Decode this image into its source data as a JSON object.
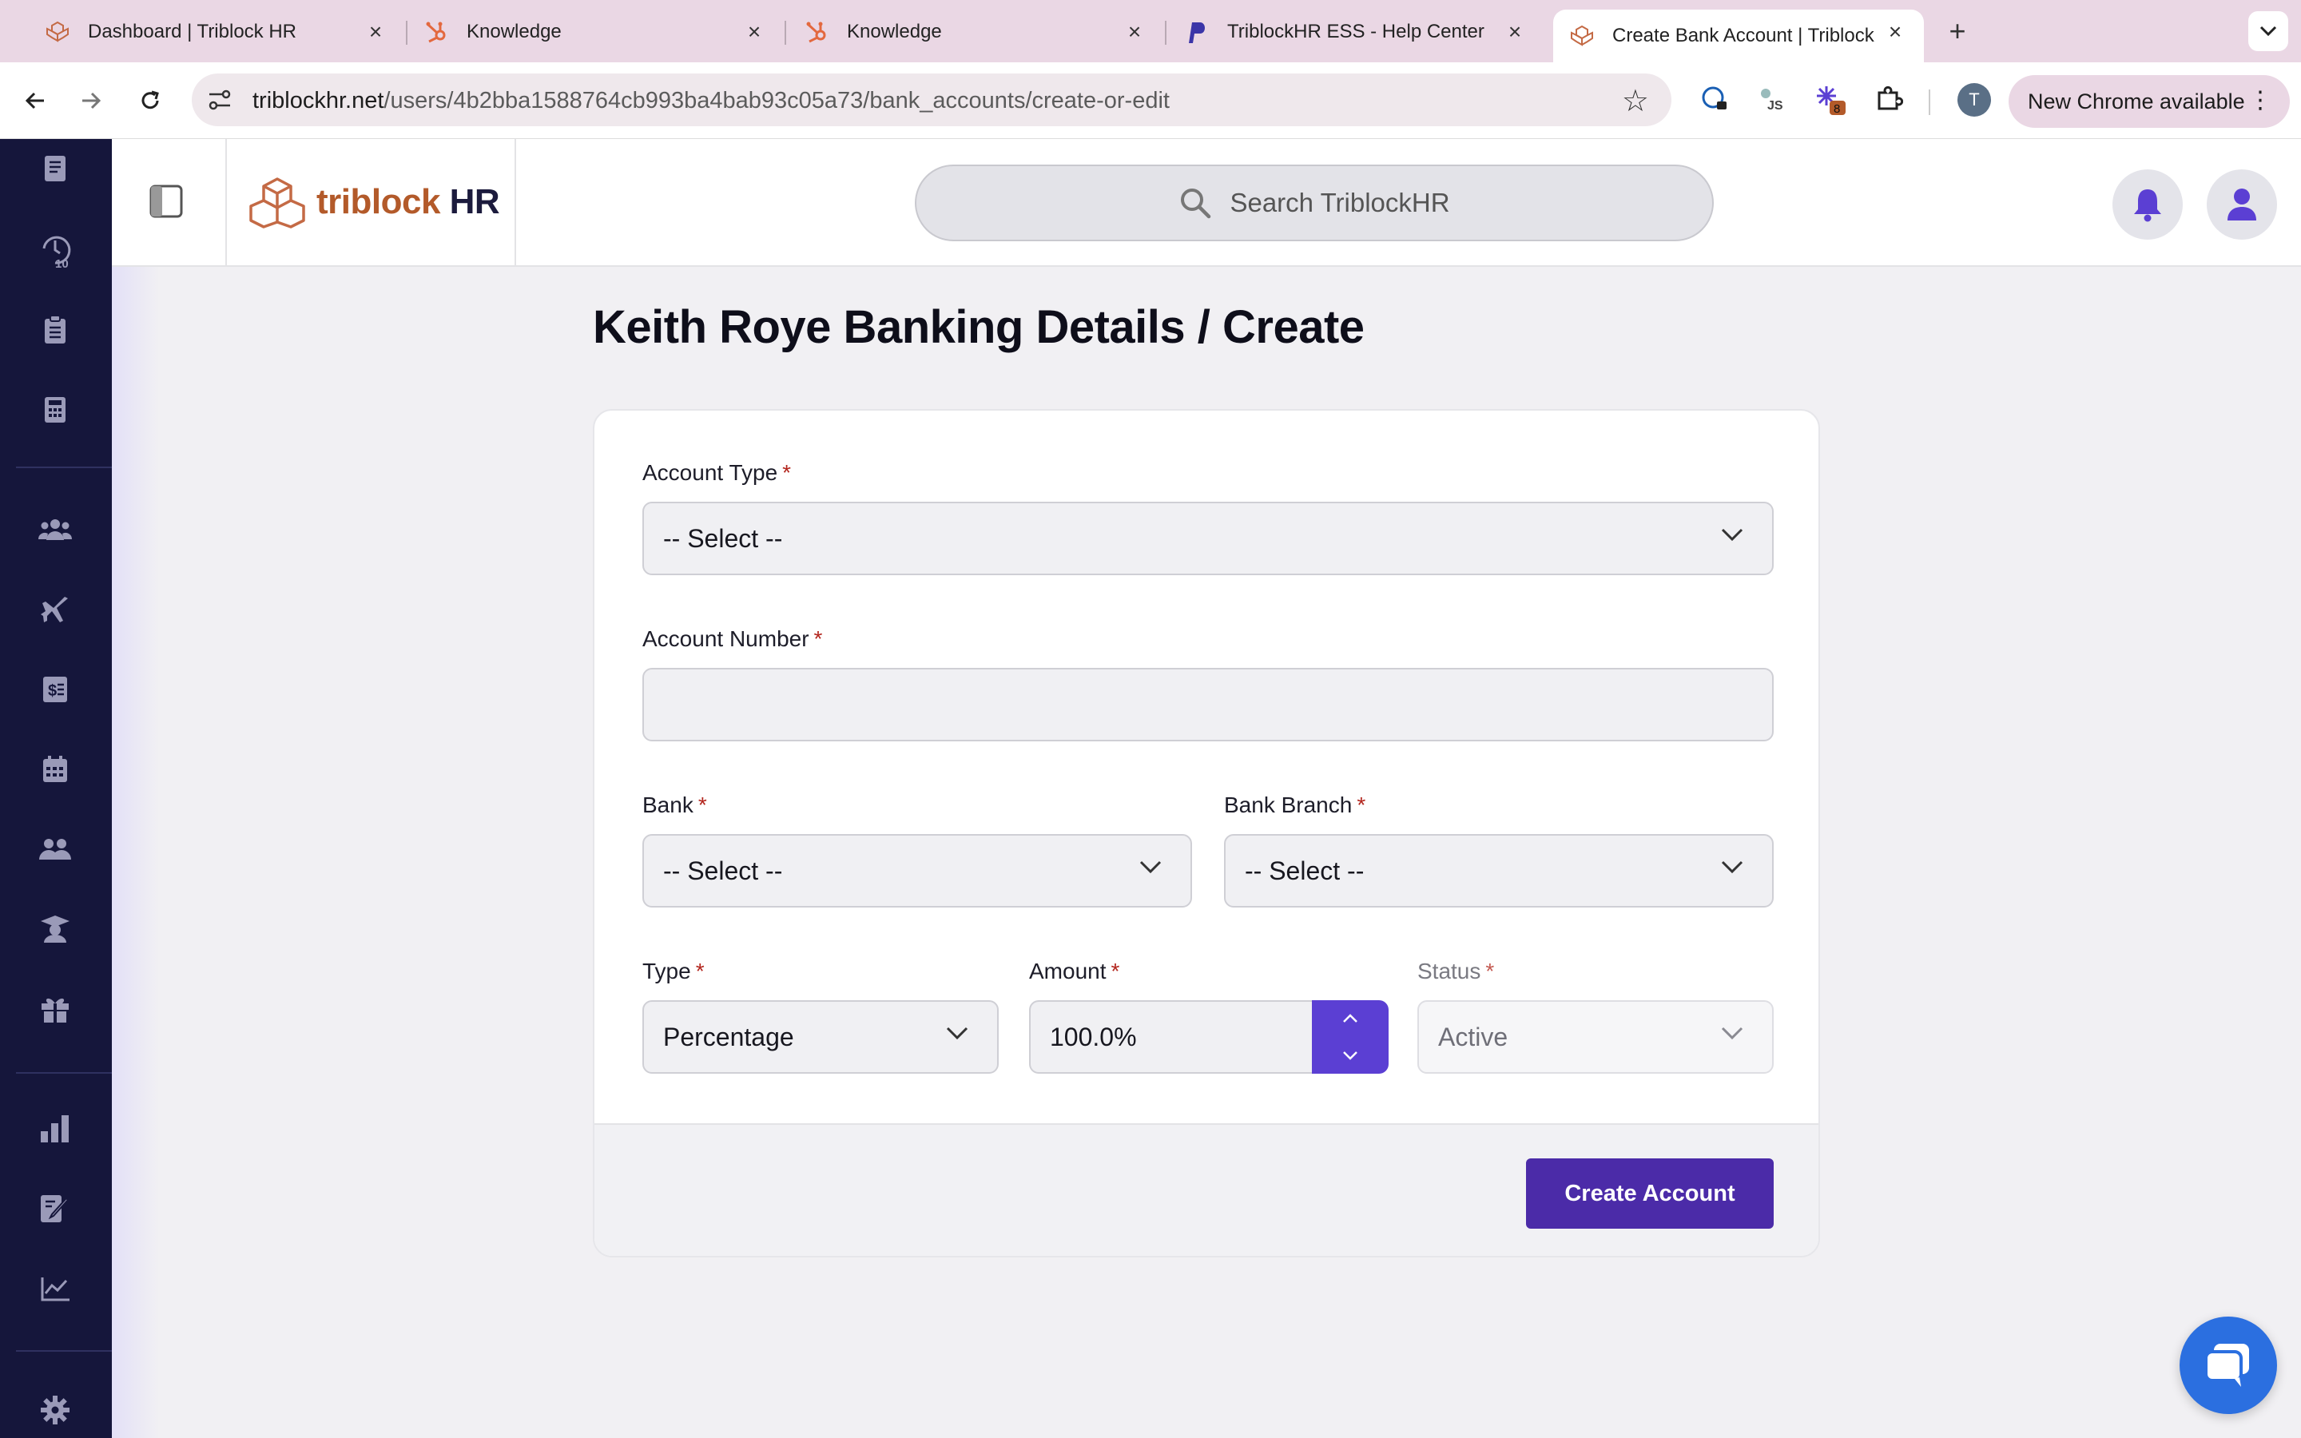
{
  "browser": {
    "tabs": [
      {
        "title": "Dashboard | Triblock HR",
        "favicon": "triblock-icon"
      },
      {
        "title": "Knowledge",
        "favicon": "hubspot-icon"
      },
      {
        "title": "Knowledge",
        "favicon": "hubspot-icon"
      },
      {
        "title": "TriblockHR ESS - Help Center",
        "favicon": "p-icon"
      },
      {
        "title": "Create Bank Account | Triblock HR",
        "favicon": "triblock-icon",
        "active": true
      }
    ],
    "url_domain": "triblockhr.net",
    "url_path": "/users/4b2bba1588764cb993ba4bab93c05a73/bank_accounts/create-or-edit",
    "update_label": "New Chrome available",
    "profile_initial": "T",
    "extension_badge": "8"
  },
  "header": {
    "logo_brand": "triblock",
    "logo_suffix": "HR",
    "search_placeholder": "Search TriblockHR"
  },
  "page": {
    "title": "Keith Roye Banking Details / Create"
  },
  "form": {
    "account_type": {
      "label": "Account Type",
      "value": "-- Select --"
    },
    "account_number": {
      "label": "Account Number",
      "value": ""
    },
    "bank": {
      "label": "Bank",
      "value": "-- Select --"
    },
    "bank_branch": {
      "label": "Bank Branch",
      "value": "-- Select --"
    },
    "type": {
      "label": "Type",
      "value": "Percentage"
    },
    "amount": {
      "label": "Amount",
      "value": "100.0%"
    },
    "status": {
      "label": "Status",
      "value": "Active"
    },
    "required_marker": "*",
    "submit_label": "Create Account"
  },
  "colors": {
    "sidebar_bg": "#15163b",
    "accent": "#4b2ba8",
    "stepper": "#5b3fd3",
    "brand_orange": "#b35a2a",
    "chat": "#2b6fe0"
  }
}
